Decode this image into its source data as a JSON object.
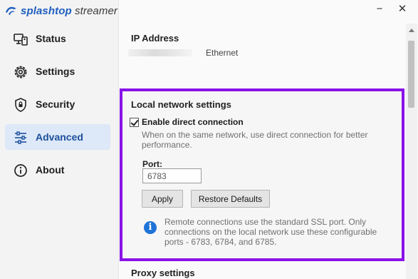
{
  "app": {
    "brand_bold": "splashtop",
    "brand_light": " streamer"
  },
  "window": {
    "minimize_glyph": "−",
    "close_glyph": "✕"
  },
  "sidebar": {
    "items": [
      {
        "label": "Status",
        "icon": "status-icon",
        "active": false
      },
      {
        "label": "Settings",
        "icon": "gear-icon",
        "active": false
      },
      {
        "label": "Security",
        "icon": "shield-icon",
        "active": false
      },
      {
        "label": "Advanced",
        "icon": "sliders-icon",
        "active": true
      },
      {
        "label": "About",
        "icon": "info-icon",
        "active": false
      }
    ]
  },
  "ip": {
    "title": "IP Address",
    "interface": "Ethernet"
  },
  "local": {
    "title": "Local network settings",
    "enable_label": "Enable direct connection",
    "enable_checked": true,
    "description": "When on the same network, use direct connection for better performance.",
    "port_label": "Port:",
    "port_value": "6783",
    "apply_label": "Apply",
    "restore_label": "Restore Defaults",
    "info_text": "Remote connections use the standard SSL port. Only connections on the local network use these configurable ports - 6783, 6784, and 6785."
  },
  "next_section": {
    "title": "Proxy settings"
  },
  "colors": {
    "accent": "#1f5fbf",
    "highlight": "#8a12e8",
    "active_bg": "#dde8f8",
    "info": "#1e73d8"
  }
}
